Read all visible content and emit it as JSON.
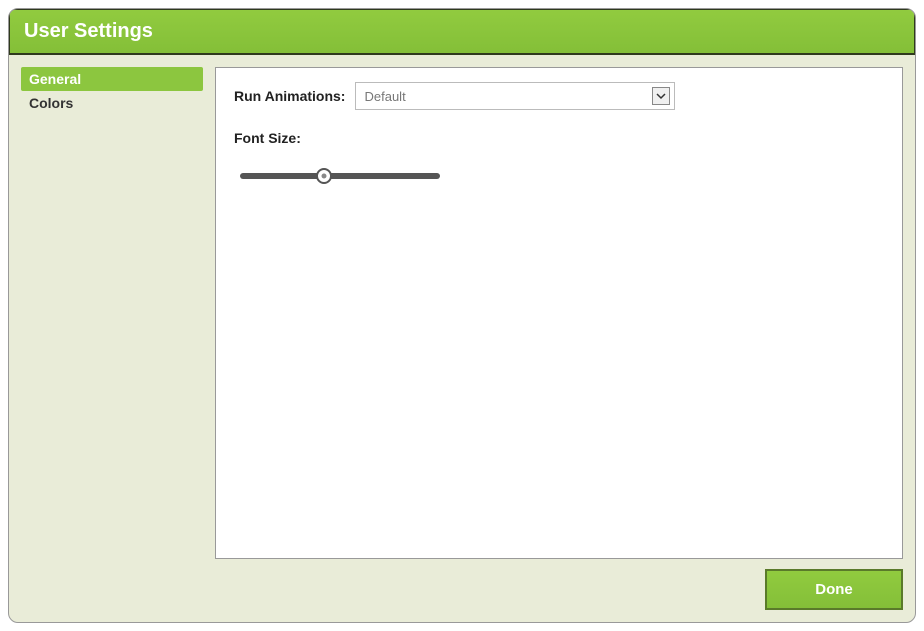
{
  "dialog": {
    "title": "User Settings"
  },
  "sidebar": {
    "items": [
      {
        "label": "General",
        "active": true
      },
      {
        "label": "Colors",
        "active": false
      }
    ]
  },
  "content": {
    "run_animations_label": "Run Animations:",
    "run_animations_value": "Default",
    "font_size_label": "Font Size:",
    "font_size_slider_percent": 42
  },
  "footer": {
    "done_label": "Done"
  }
}
